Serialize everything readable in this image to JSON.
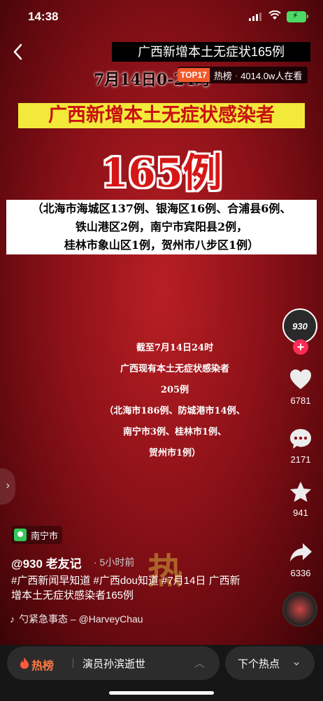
{
  "status_bar": {
    "time": "14:38",
    "battery_color": "#4cd964"
  },
  "header": {
    "back_icon": "chevron-left-icon",
    "title": "广西新增本土无症状165例"
  },
  "video": {
    "date_line": "7月14日0-24时",
    "hot_badge": {
      "tag": "TOP17",
      "label": "热榜",
      "viewers": "4014.0w人在看"
    },
    "headline": "广西新增本土无症状感染者",
    "big_number": "165例",
    "detail_lines": [
      "（北海市海城区137例、银海区16例、合浦县6例、",
      "铁山港区2例，南宁市宾阳县2例，",
      "桂林市象山区1例，贺州市八步区1例）"
    ],
    "summary_lines": [
      "截至7月14日24时",
      "广西现有本土无症状感染者",
      "205例",
      "（北海市186例、防城港市14例、",
      "南宁市3例、桂林市1例、",
      "贺州市1例）"
    ],
    "stamp_text": "热"
  },
  "actions": {
    "avatar_label": "930",
    "likes": "6781",
    "comments": "2171",
    "favorites": "941",
    "shares": "6336"
  },
  "post": {
    "location": "南宁市",
    "author": "@930 老友记",
    "time_ago": "· 5小时前",
    "description": "#广西新闻早知道 #广西dou知道 #7月14日 广西新增本土无症状感染者165例",
    "music": "勺紧急事态 – @HarveyChau"
  },
  "bottom_bar": {
    "hot_label": "热榜",
    "hot_topic": "演员孙滨逝世",
    "next_label": "下个热点",
    "accent": "#ff7a45"
  }
}
